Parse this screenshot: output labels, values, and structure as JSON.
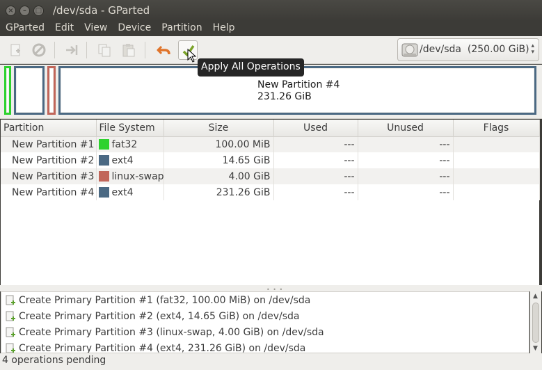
{
  "window": {
    "title": "/dev/sda - GParted"
  },
  "menu": {
    "items": [
      "GParted",
      "Edit",
      "View",
      "Device",
      "Partition",
      "Help"
    ]
  },
  "toolbar": {
    "buttons": [
      "new-partition-icon",
      "delete-icon",
      "resize-move-icon",
      "copy-icon",
      "paste-icon",
      "undo-icon",
      "apply-icon"
    ],
    "tooltip": "Apply All Operations"
  },
  "device_selector": {
    "value": "/dev/sda",
    "size": "(250.00 GiB)"
  },
  "partition_map": {
    "selected_label": "New Partition #4",
    "selected_size": "231.26 GiB",
    "colors": {
      "fat32": "#2ed22e",
      "ext4": "#4b6983",
      "linux-swap": "#c1665a"
    }
  },
  "table": {
    "headers": [
      "Partition",
      "File System",
      "Size",
      "Used",
      "Unused",
      "Flags"
    ],
    "rows": [
      {
        "partition": "New Partition #1",
        "fs": "fat32",
        "fs_color": "#2ed22e",
        "size": "100.00 MiB",
        "used": "---",
        "unused": "---",
        "flags": ""
      },
      {
        "partition": "New Partition #2",
        "fs": "ext4",
        "fs_color": "#4b6983",
        "size": "14.65 GiB",
        "used": "---",
        "unused": "---",
        "flags": ""
      },
      {
        "partition": "New Partition #3",
        "fs": "linux-swap",
        "fs_color": "#c1665a",
        "size": "4.00 GiB",
        "used": "---",
        "unused": "---",
        "flags": ""
      },
      {
        "partition": "New Partition #4",
        "fs": "ext4",
        "fs_color": "#4b6983",
        "size": "231.26 GiB",
        "used": "---",
        "unused": "---",
        "flags": ""
      }
    ]
  },
  "operations": [
    "Create Primary Partition #1 (fat32, 100.00 MiB) on /dev/sda",
    "Create Primary Partition #2 (ext4, 14.65 GiB) on /dev/sda",
    "Create Primary Partition #3 (linux-swap, 4.00 GiB) on /dev/sda",
    "Create Primary Partition #4 (ext4, 231.26 GiB) on /dev/sda"
  ],
  "status": "4 operations pending"
}
